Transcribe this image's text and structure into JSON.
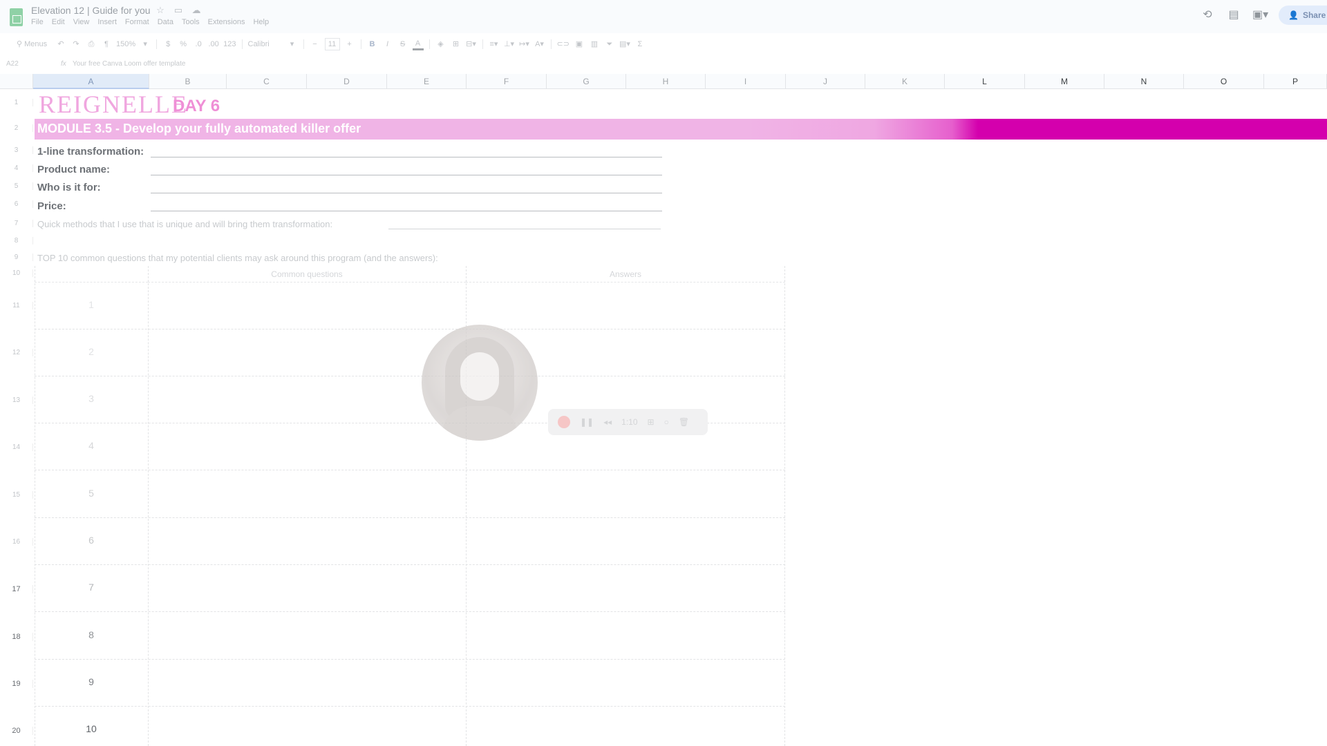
{
  "app": {
    "doc_title": "Elevation 12 | Guide for you",
    "menu": [
      "File",
      "Edit",
      "View",
      "Insert",
      "Format",
      "Data",
      "Tools",
      "Extensions",
      "Help"
    ],
    "share_label": "Share"
  },
  "toolbar": {
    "search": "Menus",
    "zoom": "150%",
    "currency": "$",
    "percent": "%",
    "dec_less": ".0",
    "dec_more": ".00",
    "number_format": "123",
    "font": "Calibri",
    "font_size": "11",
    "minus": "−",
    "plus": "+",
    "bold": "B",
    "italic": "I",
    "strike": "S",
    "text_color": "A"
  },
  "formula_bar": {
    "cell_ref": "A22",
    "fx": "fx",
    "value": "Your free Canva Loom offer template"
  },
  "columns": [
    "A",
    "B",
    "C",
    "D",
    "E",
    "F",
    "G",
    "H",
    "I",
    "J",
    "K",
    "L",
    "M",
    "N",
    "O",
    "P"
  ],
  "rows": [
    "1",
    "2",
    "3",
    "4",
    "5",
    "6",
    "7",
    "8",
    "9",
    "10",
    "11",
    "12",
    "13",
    "14",
    "15",
    "16",
    "17",
    "18",
    "19",
    "20"
  ],
  "sheet": {
    "brand": "REIGNELLE",
    "day": "DAY 6",
    "module_title": "MODULE 3.5 - Develop your fully automated killer offer",
    "fields": [
      "1-line transformation:",
      "Product name:",
      "Who is it for:",
      "Price:"
    ],
    "methods_label": "Quick methods that I use that is unique and will bring them transformation:",
    "top10_label": "TOP 10 common questions that my potential clients may ask around this program (and the answers):",
    "table_headers": {
      "questions": "Common questions",
      "answers": "Answers"
    },
    "numbers": [
      "1",
      "2",
      "3",
      "4",
      "5",
      "6",
      "7",
      "8",
      "9",
      "10"
    ]
  },
  "recorder": {
    "time": "1:10"
  },
  "colors": {
    "brand_pink": "#f0a6df",
    "module_bar_light": "#f0b4e6",
    "module_bar_dark": "#d400ad",
    "accent_blue": "#e2ecfb"
  }
}
